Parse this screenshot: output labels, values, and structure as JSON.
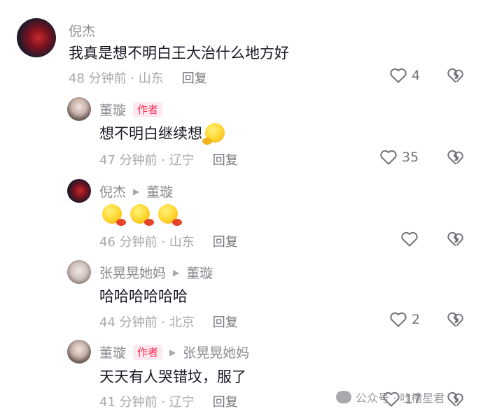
{
  "comments": [
    {
      "author": "倪杰",
      "text": "我真是想不明白王大治什么地方好",
      "time": "48 分钟前 · 山东",
      "reply_label": "回复",
      "likes": "4"
    },
    {
      "author": "董璇",
      "author_tag": "作者",
      "text": "想不明白继续想",
      "time": "47 分钟前 · 辽宁",
      "reply_label": "回复",
      "likes": "35"
    },
    {
      "author": "倪杰",
      "reply_to": "董璇",
      "text": "",
      "time": "46 分钟前 · 山东",
      "reply_label": "回复",
      "likes": ""
    },
    {
      "author": "张晃晃她妈",
      "reply_to": "董璇",
      "text": "哈哈哈哈哈哈",
      "time": "44 分钟前 · 北京",
      "reply_label": "回复",
      "likes": "2"
    },
    {
      "author": "董璇",
      "author_tag": "作者",
      "reply_to": "张晃晃她妈",
      "text": "天天有人哭错坟，服了",
      "time": "41 分钟前 · 辽宁",
      "reply_label": "回复",
      "likes": "17"
    }
  ],
  "watermark": "公众号 · 吐槽星君",
  "icons": {
    "like": "heart-outline-icon",
    "dislike": "broken-heart-icon",
    "caret": "triangle-right-icon"
  }
}
